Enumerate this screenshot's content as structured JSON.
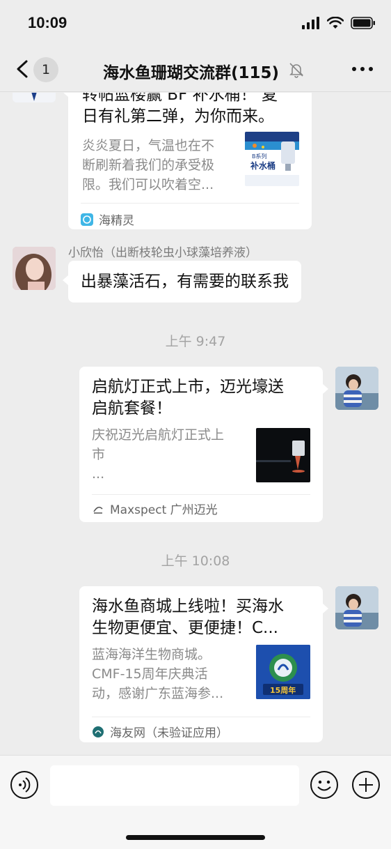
{
  "status_bar": {
    "time": "10:09"
  },
  "nav": {
    "back_count": "1",
    "title": "海水鱼珊瑚交流群(115)"
  },
  "messages": [
    {
      "kind": "card",
      "title": "转帖蓝楼赢 BF 补水桶！ 夏日有礼第二弹，为你而来。",
      "title_line1": "转帖蓝楼赢 BF 补水桶！ 夏",
      "title_line2": "日有礼第二弹，为你而来。",
      "desc_line1": "炎炎夏日，气温也在不",
      "desc_line2": "断刷新着我们的承受极",
      "desc_line3": "限。我们可以吹着空...",
      "thumb_text_top": "B系列",
      "thumb_text_main": "补水桶",
      "source": "海精灵"
    },
    {
      "kind": "text",
      "sender": "小欣怡（出断枝轮虫小球藻培养液）",
      "text": "出暴藻活石，有需要的联系我"
    },
    {
      "kind": "time",
      "text": "上午 9:47"
    },
    {
      "kind": "card",
      "title_line1": "启航灯正式上市，迈光壕送",
      "title_line2": "启航套餐！",
      "desc_line1": "庆祝迈光启航灯正式上",
      "desc_line2": "市",
      "desc_line3": "...",
      "source": "Maxspect 广州迈光"
    },
    {
      "kind": "time",
      "text": "上午 10:08"
    },
    {
      "kind": "card",
      "title_line1": "海水鱼商城上线啦！买海水",
      "title_line2": "生物更便宜、更便捷！C...",
      "desc_line1": "蓝海海洋生物商城。",
      "desc_line2": "CMF-15周年庆典活",
      "desc_line3": "动，感谢广东蓝海参...",
      "thumb_text": "15周年",
      "source": "海友网（未验证应用）"
    }
  ],
  "input": {
    "placeholder": ""
  },
  "icons": {
    "back": "chevron-left-icon",
    "mute": "bell-off-icon",
    "more": "more-dots-icon",
    "voice": "voice-icon",
    "emoji": "emoji-icon",
    "plus": "plus-circle-icon"
  },
  "colors": {
    "background": "#ededed",
    "bubble": "#ffffff",
    "muted_text": "#8a8a8a"
  }
}
